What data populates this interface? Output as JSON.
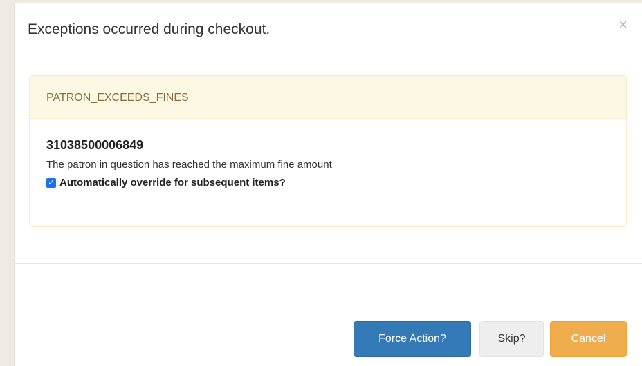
{
  "modal": {
    "title": "Exceptions occurred during checkout.",
    "close_glyph": "×"
  },
  "exception": {
    "code": "PATRON_EXCEEDS_FINES",
    "barcode": "31038500006849",
    "message": "The patron in question has reached the maximum fine amount",
    "override_label": "Automatically override for subsequent items?",
    "override_checked": true
  },
  "footer": {
    "force_label": "Force Action?",
    "skip_label": "Skip?",
    "cancel_label": "Cancel"
  },
  "colors": {
    "primary": "#337ab7",
    "warning": "#f0ad4e",
    "panel_heading_bg": "#fcf8e3",
    "panel_heading_text": "#8a6d3b"
  }
}
